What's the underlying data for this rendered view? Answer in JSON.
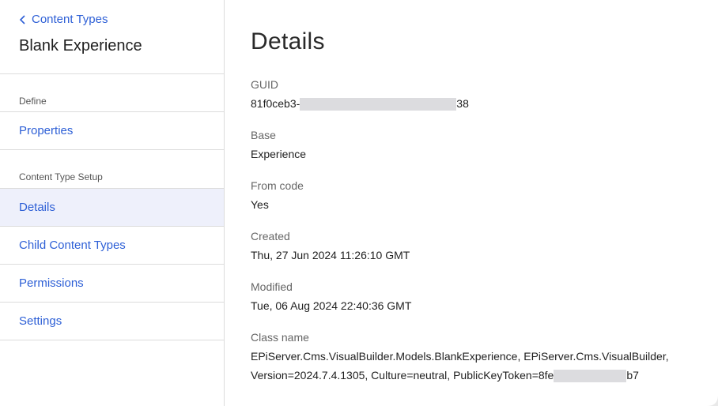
{
  "sidebar": {
    "back_label": "Content Types",
    "title": "Blank Experience",
    "sections": {
      "define": "Define",
      "setup": "Content Type Setup"
    },
    "items": [
      {
        "label": "Properties"
      },
      {
        "label": "Details"
      },
      {
        "label": "Child Content Types"
      },
      {
        "label": "Permissions"
      },
      {
        "label": "Settings"
      }
    ]
  },
  "main": {
    "title": "Details",
    "fields": {
      "guid": {
        "label": "GUID",
        "value_start": "81f0ceb3-",
        "value_end": "38"
      },
      "base": {
        "label": "Base",
        "value": "Experience"
      },
      "from_code": {
        "label": "From code",
        "value": "Yes"
      },
      "created": {
        "label": "Created",
        "value": "Thu, 27 Jun 2024 11:26:10 GMT"
      },
      "modified": {
        "label": "Modified",
        "value": "Tue, 06 Aug 2024 22:40:36 GMT"
      },
      "class_name": {
        "label": "Class name",
        "line1": "EPiServer.Cms.VisualBuilder.Models.BlankExperience, EPiServer.Cms.VisualBuilder,",
        "line2_start": "Version=2024.7.4.1305, Culture=neutral, PublicKeyToken=8fe",
        "line2_end": "b7"
      }
    }
  },
  "colors": {
    "link": "#2d5fd6",
    "active_bg": "#eef0fb",
    "redaction": "#dcdcdf",
    "divider": "#dcdcdc"
  }
}
